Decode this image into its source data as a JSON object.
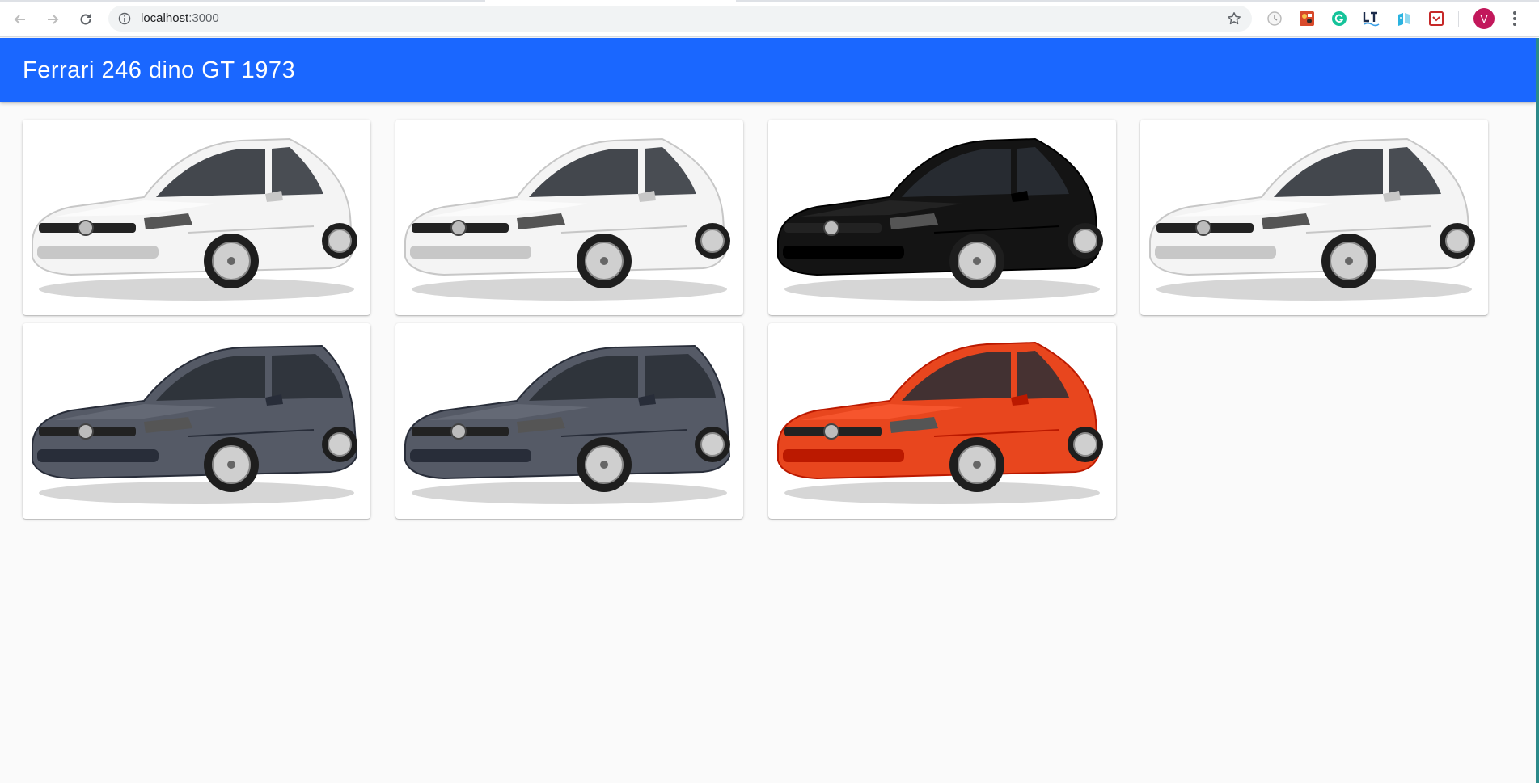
{
  "browser": {
    "url_host": "localhost",
    "url_port": ":3000",
    "profile_initial": "V",
    "extensions": [
      "clock-extension-icon",
      "puzzle-extension-icon",
      "grammarly-icon",
      "lt-extension-icon",
      "translate-extension-icon",
      "pocket-icon"
    ]
  },
  "app": {
    "title": "Ferrari 246 dino GT 1973",
    "accent_color": "#1a67ff"
  },
  "cars": [
    {
      "name": "car-card-1",
      "model": "hatchback",
      "color": "#f4f4f4"
    },
    {
      "name": "car-card-2",
      "model": "hatchback",
      "color": "#f4f4f4"
    },
    {
      "name": "car-card-3",
      "model": "hatchback",
      "color": "#141414"
    },
    {
      "name": "car-card-4",
      "model": "hatchback",
      "color": "#f4f4f4"
    },
    {
      "name": "car-card-5",
      "model": "wagon",
      "color": "#555a66"
    },
    {
      "name": "car-card-6",
      "model": "wagon",
      "color": "#555a66"
    },
    {
      "name": "car-card-7",
      "model": "small-hatch",
      "color": "#e8461e"
    }
  ]
}
